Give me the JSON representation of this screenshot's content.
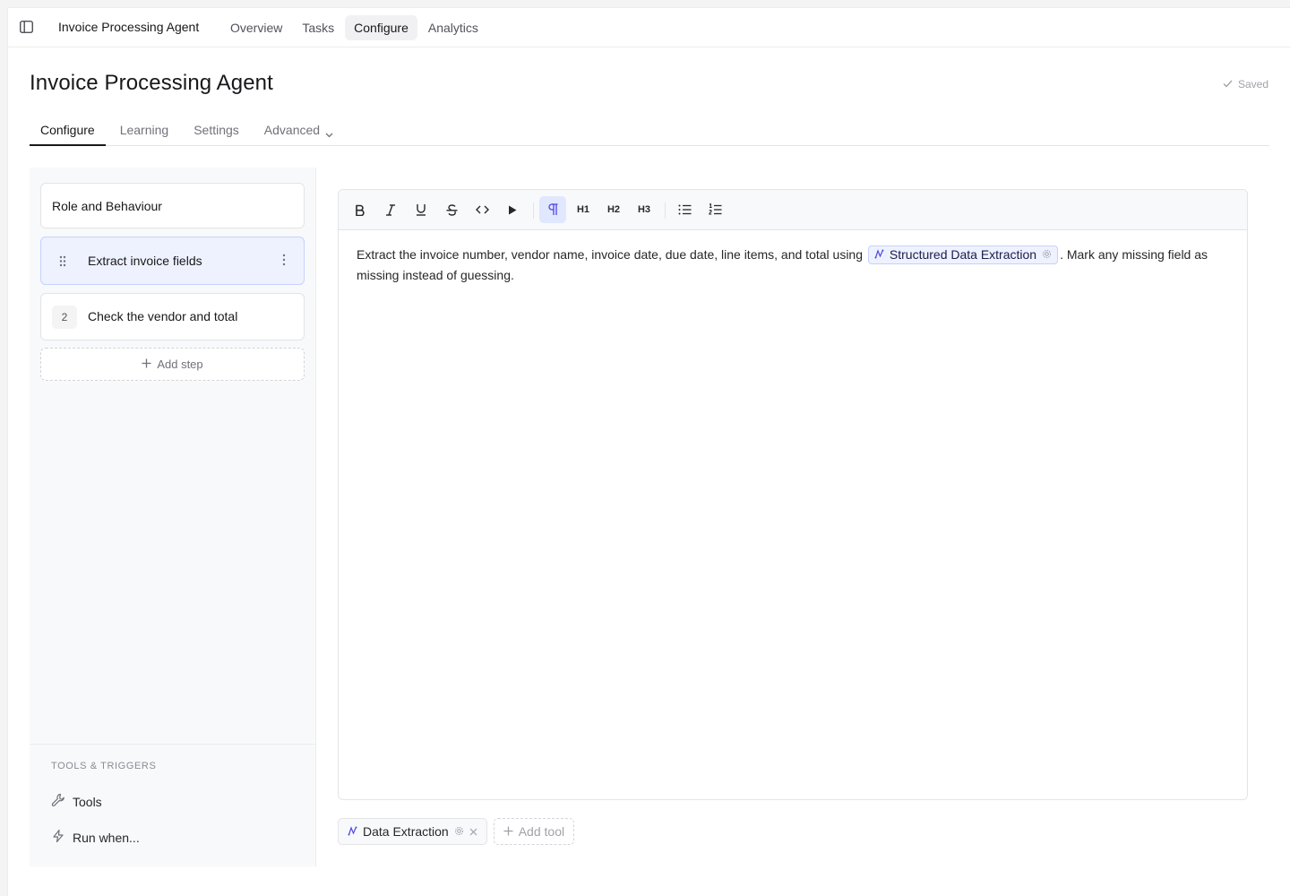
{
  "app": {
    "title": "Invoice Processing Agent"
  },
  "topnav": {
    "items": [
      {
        "label": "Overview"
      },
      {
        "label": "Tasks"
      },
      {
        "label": "Configure",
        "active": true
      },
      {
        "label": "Analytics"
      }
    ]
  },
  "page": {
    "title": "Invoice Processing Agent",
    "saved_label": "Saved"
  },
  "subtabs": {
    "items": [
      {
        "label": "Configure",
        "active": true
      },
      {
        "label": "Learning"
      },
      {
        "label": "Settings"
      },
      {
        "label": "Advanced",
        "has_dropdown": true
      }
    ]
  },
  "steps": {
    "role_label": "Role and Behaviour",
    "items": [
      {
        "label": "Extract invoice fields",
        "selected": true
      },
      {
        "number": "2",
        "label": "Check the vendor and total"
      }
    ],
    "add_label": "Add step"
  },
  "tools_triggers": {
    "heading": "TOOLS & TRIGGERS",
    "tools_label": "Tools",
    "run_when_label": "Run when..."
  },
  "toolbar": {
    "buttons": [
      "bold-icon",
      "italic-icon",
      "underline-icon",
      "strikethrough-icon",
      "code-icon",
      "play-icon",
      "paragraph-icon",
      "heading-1-icon",
      "heading-2-icon",
      "heading-3-icon",
      "bullet-list-icon",
      "numbered-list-icon"
    ],
    "active": "paragraph-icon",
    "h1": "H1",
    "h2": "H2",
    "h3": "H3"
  },
  "editor": {
    "text_before": "Extract the invoice number, vendor name, invoice date, due date, line items, and total using",
    "chip_label": "Structured Data Extraction",
    "text_after": ". Mark any missing field as missing instead of guessing."
  },
  "bottom_tools": {
    "chip_label": "Data Extraction",
    "add_label": "Add tool"
  },
  "colors": {
    "accent_bg": "#eef2ff",
    "accent_border": "#c7d2fe",
    "accent_icon": "#4f46e5"
  }
}
